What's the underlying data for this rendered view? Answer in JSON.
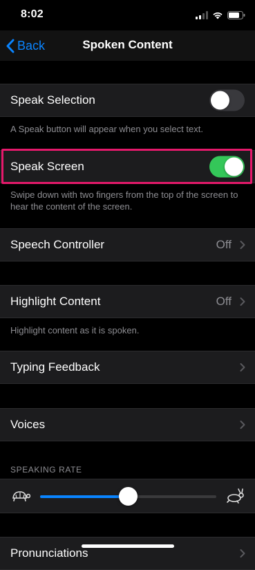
{
  "status_bar": {
    "time": "8:02"
  },
  "nav": {
    "back_label": "Back",
    "title": "Spoken Content"
  },
  "speak_selection": {
    "label": "Speak Selection",
    "enabled": false,
    "footer": "A Speak button will appear when you select text."
  },
  "speak_screen": {
    "label": "Speak Screen",
    "enabled": true,
    "footer": "Swipe down with two fingers from the top of the screen to hear the content of the screen."
  },
  "speech_controller": {
    "label": "Speech Controller",
    "value": "Off"
  },
  "highlight_content": {
    "label": "Highlight Content",
    "value": "Off",
    "footer": "Highlight content as it is spoken."
  },
  "typing_feedback": {
    "label": "Typing Feedback"
  },
  "voices": {
    "label": "Voices"
  },
  "speaking_rate": {
    "header": "SPEAKING RATE",
    "value": 0.5
  },
  "pronunciations": {
    "label": "Pronunciations"
  },
  "colors": {
    "accent": "#0a84ff",
    "toggle_on": "#34c759",
    "highlight": "#e5196b"
  }
}
